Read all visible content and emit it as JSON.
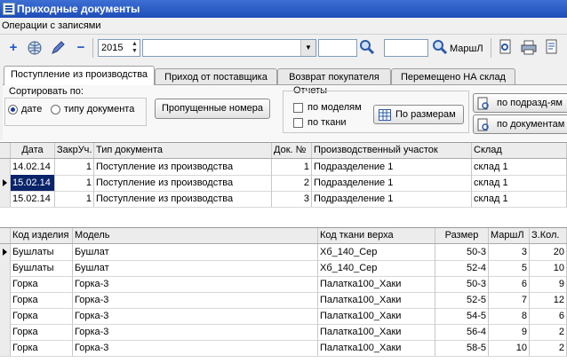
{
  "window": {
    "title": "Приходные документы"
  },
  "menu": {
    "label": "Операции с записями"
  },
  "toolbar": {
    "year": "2015",
    "combo_value": "",
    "field2": "",
    "field3": "",
    "route_label": "МаршЛ"
  },
  "tabs": [
    {
      "label": "Поступление из производства",
      "active": true
    },
    {
      "label": "Приход от поставщика",
      "active": false
    },
    {
      "label": "Возврат покупателя",
      "active": false
    },
    {
      "label": "Перемещено НА склад",
      "active": false
    }
  ],
  "sort": {
    "title": "Сортировать по:",
    "opt_date": "дате",
    "opt_type": "типу документа",
    "selected": "дате"
  },
  "missing_button": "Пропущенные номера",
  "reports": {
    "title": "Отчеты",
    "by_models": "по моделям",
    "by_fabric": "по ткани",
    "by_sizes": "По размерам",
    "by_dept": "по подразд-ям",
    "by_docs": "по документам"
  },
  "docs_table": {
    "headers": [
      "Дата",
      "ЗакрУч.",
      "Тип документа",
      "Док. №",
      "Производственный участок",
      "Склад"
    ],
    "rows": [
      [
        "14.02.14",
        "1",
        "Поступление из производства",
        "1",
        "Подразделение 1",
        "склад 1"
      ],
      [
        "15.02.14",
        "1",
        "Поступление из производства",
        "2",
        "Подразделение 1",
        "склад 1"
      ],
      [
        "15.02.14",
        "1",
        "Поступление из производства",
        "3",
        "Подразделение 1",
        "склад 1"
      ]
    ],
    "selected_row": 1
  },
  "items_table": {
    "headers": [
      "Код изделия",
      "Модель",
      "Код ткани верха",
      "Размер",
      "МаршЛ",
      "З.Кол."
    ],
    "rows": [
      [
        "Бушлаты",
        "Бушлат",
        "Хб_140_Сер",
        "50-3",
        "3",
        "20"
      ],
      [
        "Бушлаты",
        "Бушлат",
        "Хб_140_Сер",
        "52-4",
        "5",
        "10"
      ],
      [
        "Горка",
        "Горка-3",
        "Палатка100_Хаки",
        "50-3",
        "6",
        "9"
      ],
      [
        "Горка",
        "Горка-3",
        "Палатка100_Хаки",
        "52-5",
        "7",
        "12"
      ],
      [
        "Горка",
        "Горка-3",
        "Палатка100_Хаки",
        "54-5",
        "8",
        "6"
      ],
      [
        "Горка",
        "Горка-3",
        "Палатка100_Хаки",
        "56-4",
        "9",
        "2"
      ],
      [
        "Горка",
        "Горка-3",
        "Палатка100_Хаки",
        "58-5",
        "10",
        "2"
      ]
    ],
    "current_row": 0
  },
  "colors": {
    "title_bar": "#1e4db8",
    "selection": "#0a246a"
  },
  "icons": [
    "add-icon",
    "globe-icon",
    "edit-pen-icon",
    "delete-icon",
    "search-icon",
    "search-icon",
    "preview-icon",
    "print-icon",
    "report-icon"
  ]
}
